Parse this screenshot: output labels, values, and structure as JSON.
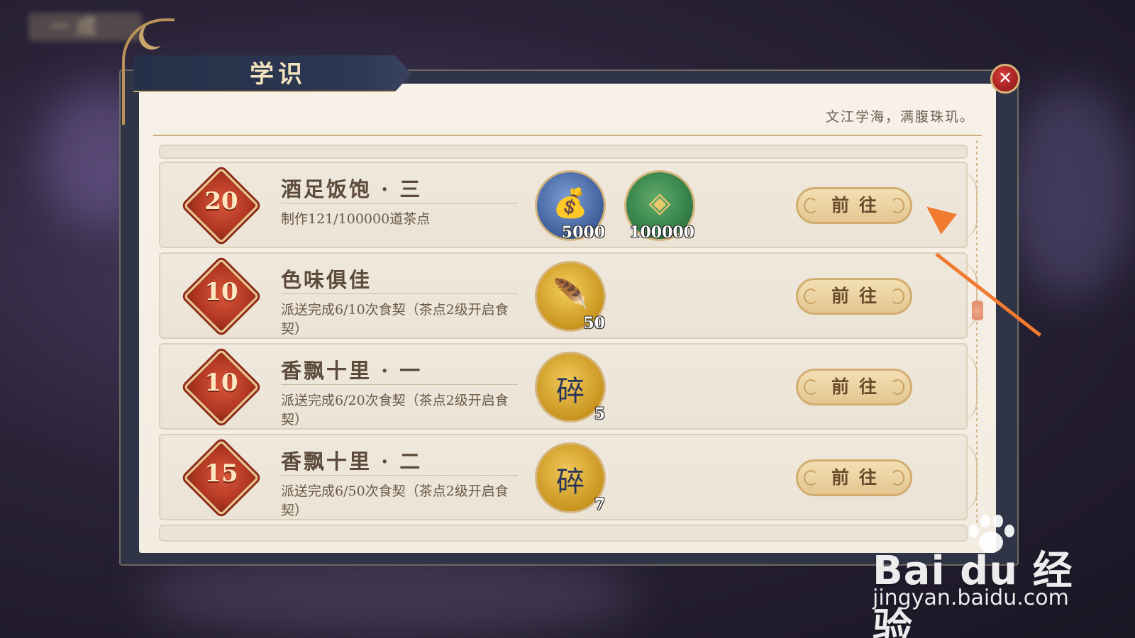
{
  "colors": {
    "panel_frame": "#2f3446",
    "panel_paper": "#f4ede2",
    "accent_gold": "#c9a66b",
    "badge_red": "#b23722",
    "close_red": "#a01f1f",
    "annotation_arrow": "#f07a2f"
  },
  "background": {
    "blurred_label": "一 成"
  },
  "dialog": {
    "title": "学识",
    "motto": "文江学海，满腹珠玑。",
    "close_icon": "close-icon",
    "close_glyph": "✕"
  },
  "tasks": [
    {
      "badge": "20",
      "title": "酒足饭饱 · 三",
      "desc": "制作121/100000道茶点",
      "rewards": [
        {
          "icon": "coin-pouch-icon",
          "glyph": "💰",
          "qty": "5000"
        },
        {
          "icon": "jade-coin-icon",
          "glyph": "◈",
          "qty": "100000"
        }
      ],
      "button": "前往"
    },
    {
      "badge": "10",
      "title": "色味俱佳",
      "desc": "派送完成6/10次食契（茶点2级开启食契）",
      "rewards": [
        {
          "icon": "golden-feather-icon",
          "glyph": "🪶",
          "qty": "50"
        }
      ],
      "button": "前往"
    },
    {
      "badge": "10",
      "title": "香飘十里 · 一",
      "desc": "派送完成6/20次食契（茶点2级开启食契）",
      "rewards": [
        {
          "icon": "fragment-pouch-icon",
          "glyph": "碎",
          "qty": "5"
        }
      ],
      "button": "前往"
    },
    {
      "badge": "15",
      "title": "香飘十里 · 二",
      "desc": "派送完成6/50次食契（茶点2级开启食契）",
      "rewards": [
        {
          "icon": "fragment-pouch-icon",
          "glyph": "碎",
          "qty": "7"
        }
      ],
      "button": "前往"
    }
  ],
  "watermark": {
    "logo": "Bai du 经验",
    "url": "jingyan.baidu.com"
  }
}
